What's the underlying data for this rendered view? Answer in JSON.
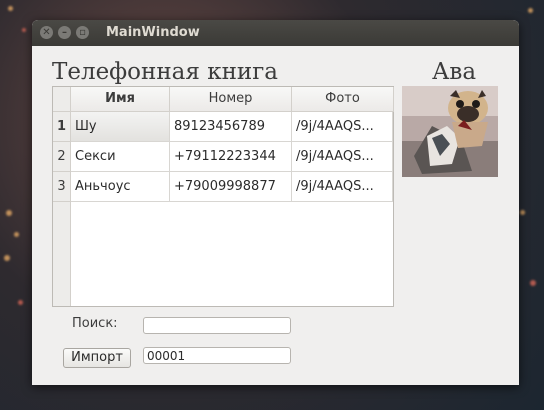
{
  "window": {
    "title": "MainWindow"
  },
  "headings": {
    "phonebook": "Телефонная книга",
    "avatar": "Ава"
  },
  "table": {
    "columns": [
      "Имя",
      "Номер",
      "Фото"
    ],
    "rows": [
      {
        "index": "1",
        "name": "Шу",
        "number": "89123456789",
        "photo": "/9j/4AAQS..."
      },
      {
        "index": "2",
        "name": "Секси",
        "number": "+79112223344",
        "photo": "/9j/4AAQS..."
      },
      {
        "index": "3",
        "name": "Аньчоус",
        "number": "+79009998877",
        "photo": "/9j/4AAQS..."
      }
    ]
  },
  "search": {
    "label": "Поиск:",
    "value": ""
  },
  "import": {
    "button_label": "Импорт",
    "value": "00001"
  },
  "avatar": {
    "image": "pug-photo"
  },
  "colors": {
    "window_bg": "#f0efee",
    "titlebar": "#3b3a36"
  }
}
